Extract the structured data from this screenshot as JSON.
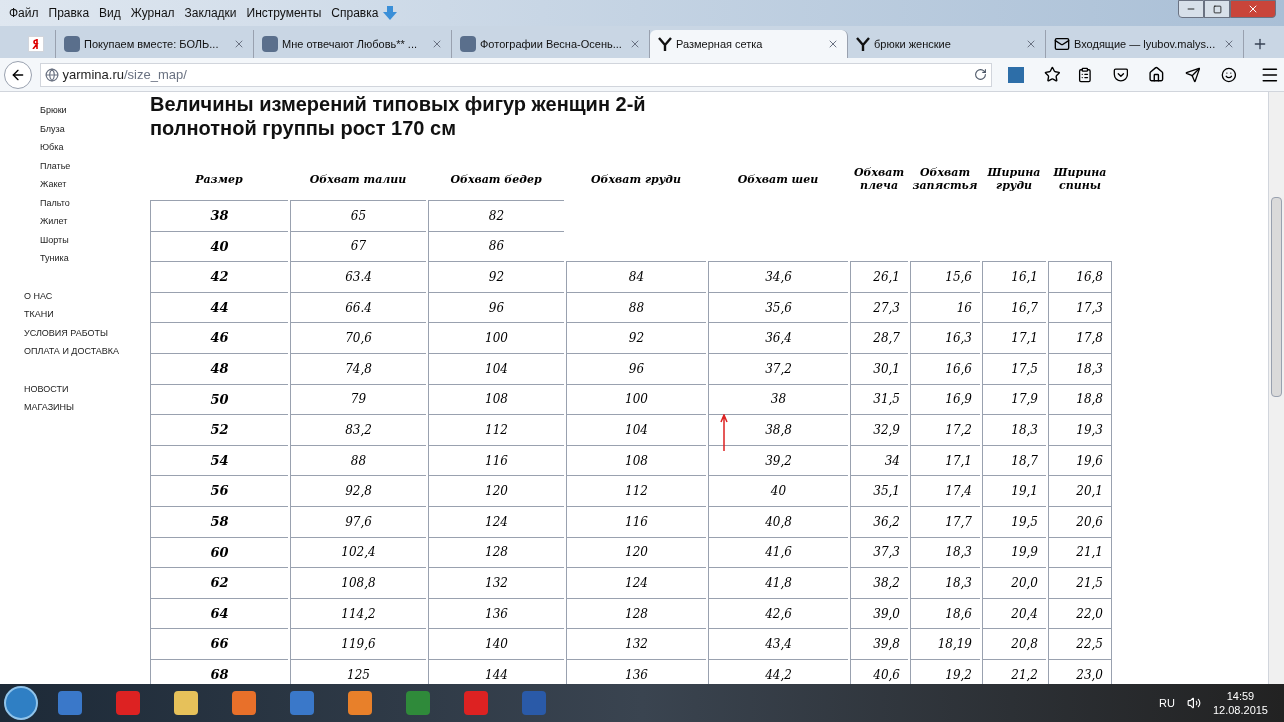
{
  "menu": [
    "Файл",
    "Правка",
    "Вид",
    "Журнал",
    "Закладки",
    "Инструменты",
    "Справка"
  ],
  "tabs": [
    {
      "kind": "pinned",
      "selected": false
    },
    {
      "kind": "ru",
      "title": "Покупаем вместе: БОЛЬ...",
      "selected": false
    },
    {
      "kind": "ru",
      "title": "Мне отвечают Любовь** ...",
      "selected": false
    },
    {
      "kind": "ru",
      "title": "Фотографии Весна-Осень...",
      "selected": false
    },
    {
      "kind": "y",
      "title": "Размерная сетка",
      "selected": true
    },
    {
      "kind": "y",
      "title": "брюки женские",
      "selected": false
    },
    {
      "kind": "mail",
      "title": "Входящие — lyubov.malys...",
      "selected": false
    }
  ],
  "url": {
    "domain": "yarmina.ru",
    "path": "/size_map/"
  },
  "sidebar": {
    "categories": [
      "Брюки",
      "Блуза",
      "Юбка",
      "Платье",
      "Жакет",
      "Пальто",
      "Жилет",
      "Шорты",
      "Туника"
    ],
    "links": [
      "О НАС",
      "ТКАНИ",
      "УСЛОВИЯ РАБОТЫ",
      "ОПЛАТА И ДОСТАВКА"
    ],
    "links2": [
      "НОВОСТИ",
      "МАГАЗИНЫ"
    ]
  },
  "heading": [
    "Величины измерений типовых фигур женщин 2-й",
    "полнотной группы рост 170 см"
  ],
  "table": {
    "columns": [
      "Размер",
      "Обхват талии",
      "Обхват бедер",
      "Обхват груди",
      "Обхват шеи",
      "Обхват плеча",
      "Обхват запястья",
      "Ширина груди",
      "Ширина спины"
    ],
    "rows": [
      [
        "38",
        "65",
        "82"
      ],
      [
        "40",
        "67",
        "86"
      ],
      [
        "42",
        "63.4",
        "92",
        "84",
        "34,6",
        "26,1",
        "15,6",
        "16,1",
        "16,8"
      ],
      [
        "44",
        "66.4",
        "96",
        "88",
        "35,6",
        "27,3",
        "16",
        "16,7",
        "17,3"
      ],
      [
        "46",
        "70,6",
        "100",
        "92",
        "36,4",
        "28,7",
        "16,3",
        "17,1",
        "17,8"
      ],
      [
        "48",
        "74,8",
        "104",
        "96",
        "37,2",
        "30,1",
        "16,6",
        "17,5",
        "18,3"
      ],
      [
        "50",
        "79",
        "108",
        "100",
        "38",
        "31,5",
        "16,9",
        "17,9",
        "18,8"
      ],
      [
        "52",
        "83,2",
        "112",
        "104",
        "38,8",
        "32,9",
        "17,2",
        "18,3",
        "19,3"
      ],
      [
        "54",
        "88",
        "116",
        "108",
        "39,2",
        "34",
        "17,1",
        "18,7",
        "19,6"
      ],
      [
        "56",
        "92,8",
        "120",
        "112",
        "40",
        "35,1",
        "17,4",
        "19,1",
        "20,1"
      ],
      [
        "58",
        "97,6",
        "124",
        "116",
        "40,8",
        "36,2",
        "17,7",
        "19,5",
        "20,6"
      ],
      [
        "60",
        "102,4",
        "128",
        "120",
        "41,6",
        "37,3",
        "18,3",
        "19,9",
        "21,1"
      ],
      [
        "62",
        "108,8",
        "132",
        "124",
        "41,8",
        "38,2",
        "18,3",
        "20,0",
        "21,5"
      ],
      [
        "64",
        "114,2",
        "136",
        "128",
        "42,6",
        "39,0",
        "18,6",
        "20,4",
        "22,0"
      ],
      [
        "66",
        "119,6",
        "140",
        "132",
        "43,4",
        "39,8",
        "18,19",
        "20,8",
        "22,5"
      ],
      [
        "68",
        "125",
        "144",
        "136",
        "44,2",
        "40,6",
        "19,2",
        "21,2",
        "23,0"
      ]
    ]
  },
  "taskbar": {
    "language": "RU",
    "time": "14:59",
    "date": "12.08.2015"
  }
}
